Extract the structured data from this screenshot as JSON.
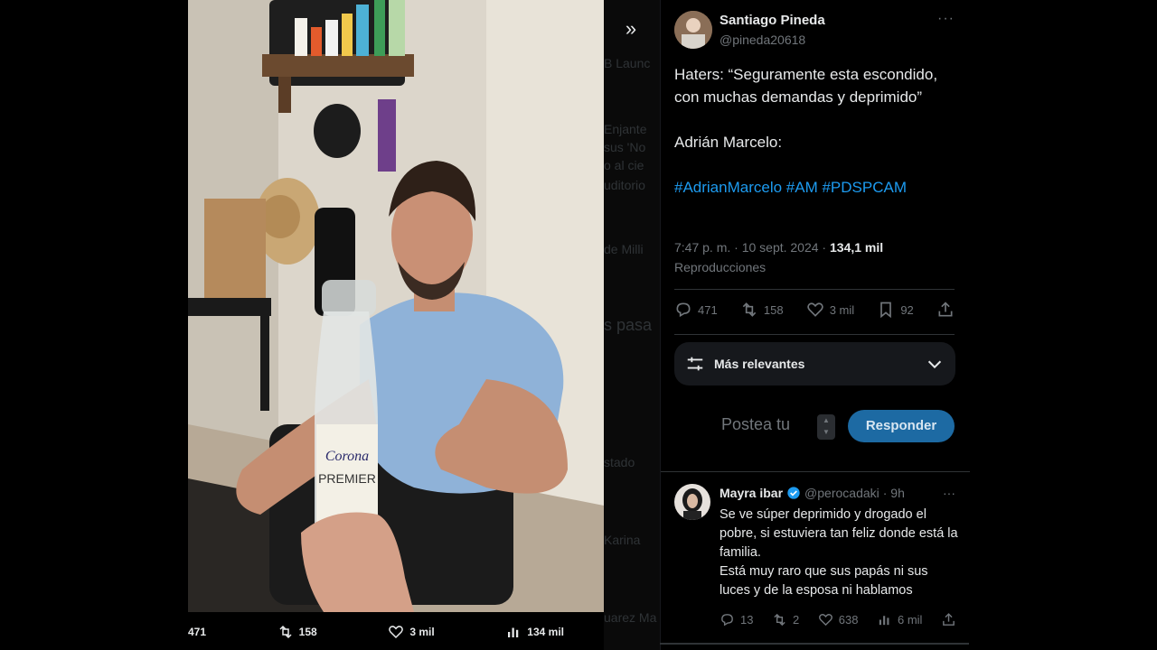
{
  "media": {
    "stats": [
      {
        "icon": "reply-icon",
        "value": "471"
      },
      {
        "icon": "retweet-icon",
        "value": "158"
      },
      {
        "icon": "like-icon",
        "value": "3 mil"
      },
      {
        "icon": "views-icon",
        "value": "134 mil"
      }
    ],
    "bottle_brand": "Corona",
    "bottle_label": "PREMIER"
  },
  "background_timeline": {
    "fragments": [
      "B Launc",
      "Enjante",
      "sus 'No",
      "o al cie",
      "uditorio",
      "de Milli",
      "s pasa",
      "stado",
      "Karina",
      "uarez Ma"
    ]
  },
  "tweet": {
    "author_name": "Santiago Pineda",
    "author_handle": "@pineda20618",
    "text_1": "Haters: “Seguramente esta escondido, con muchas demandas y deprimido”",
    "text_2": "Adrián Marcelo:",
    "hashtags": "#AdrianMarcelo #AM #PDSPCAM",
    "time": "7:47 p. m. · 10 sept. 2024 · ",
    "views": "134,1 mil",
    "views_label": "Reproducciones",
    "actions": {
      "replies": "471",
      "retweets": "158",
      "likes": "3 mil",
      "bookmarks": "92"
    }
  },
  "sort": {
    "label": "Más relevantes"
  },
  "compose": {
    "placeholder": "Postea tu",
    "button": "Responder"
  },
  "reply": {
    "name": "Mayra ibar",
    "handle": "@perocadaki",
    "age": "· 9h",
    "text": "Se ve súper deprimido y drogado el pobre, si estuviera tan feliz donde está la familia.",
    "text_2": "Está muy raro que sus papás ni sus luces y de la esposa ni hablamos",
    "actions": {
      "replies": "13",
      "retweets": "2",
      "likes": "638",
      "views": "6 mil"
    }
  },
  "colors": {
    "background": "#000000",
    "accent": "#1d9bf0",
    "muted": "#71767b",
    "text": "#e7e9ea"
  }
}
